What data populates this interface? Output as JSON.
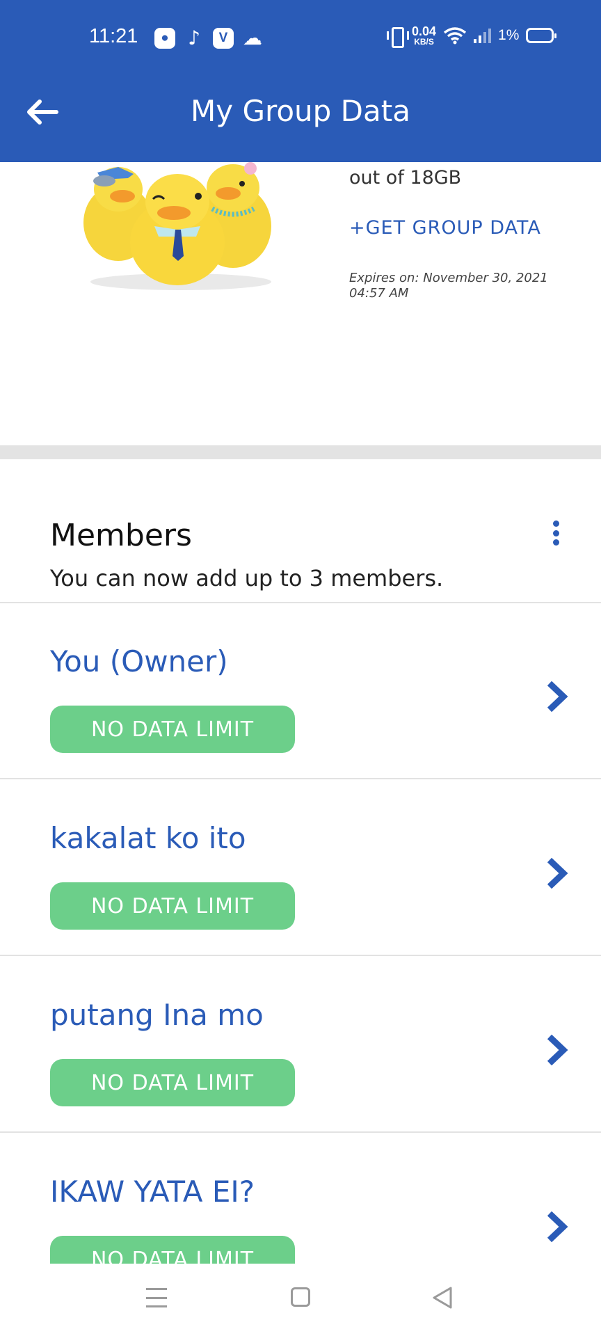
{
  "status_bar": {
    "time": "11:21",
    "speed_value": "0.04",
    "speed_unit": "KB/S",
    "battery": "1%",
    "icons": [
      "app-badge-icon",
      "tiktok-icon",
      "viber-icon",
      "cloud-icon",
      "vibrate-icon",
      "wifi-icon",
      "signal-icon",
      "battery-icon"
    ]
  },
  "header": {
    "title": "My Group Data",
    "back_icon": "arrow-left-icon"
  },
  "hero": {
    "out_of": "out of 18GB",
    "get_group_data": "+GET GROUP DATA",
    "expires": "Expires on: November 30, 2021 04:57 AM"
  },
  "members": {
    "title": "Members",
    "subtitle": "You can now add up to 3 members.",
    "items": [
      {
        "name": "You (Owner)",
        "limit": "NO DATA LIMIT"
      },
      {
        "name": "kakalat ko ito",
        "limit": "NO DATA LIMIT"
      },
      {
        "name": "putang Ina mo",
        "limit": "NO DATA LIMIT"
      },
      {
        "name": "IKAW YATA EI?",
        "limit": "NO DATA LIMIT"
      }
    ]
  },
  "colors": {
    "brand_blue": "#2a5bb7",
    "pill_green": "#6ccf8a",
    "divider": "#e3e3e3"
  }
}
